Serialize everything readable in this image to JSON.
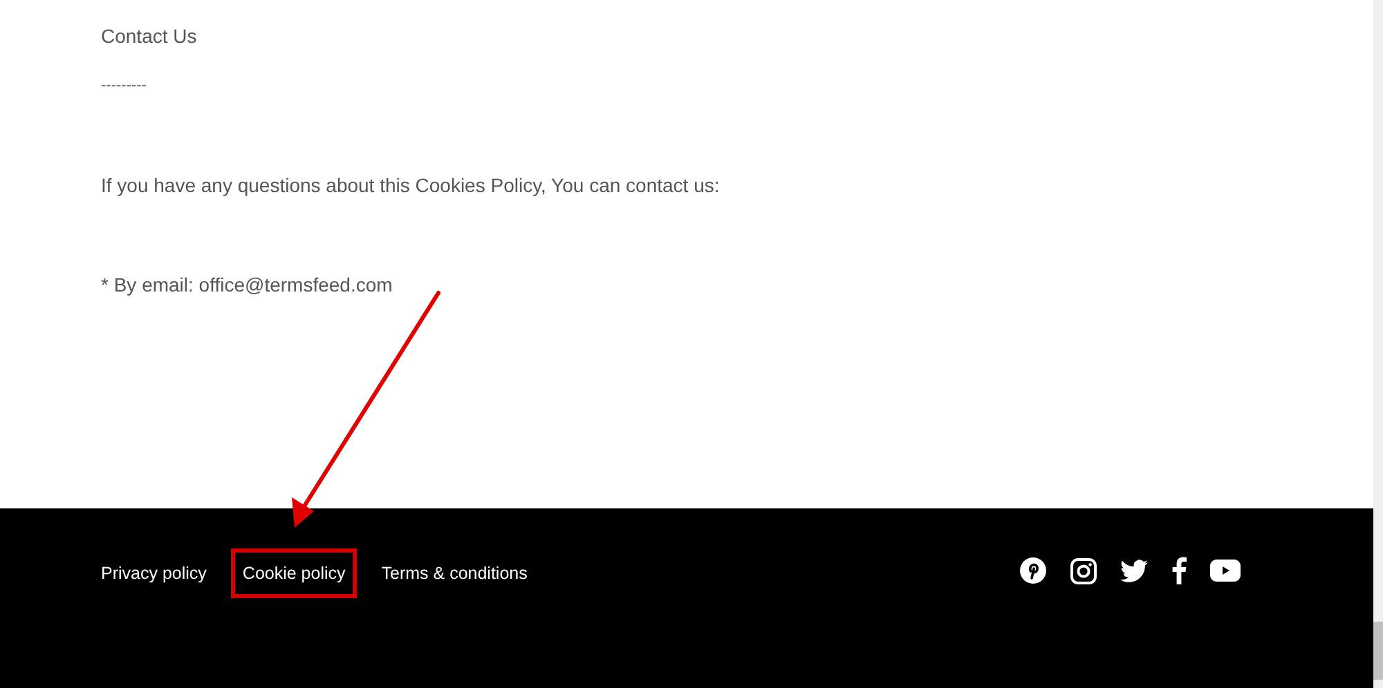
{
  "content": {
    "heading": "Contact Us",
    "separator": "---------",
    "paragraphs": [
      "If you have any questions about this Cookies Policy, You can contact us:",
      "* By email: office@termsfeed.com"
    ]
  },
  "footer": {
    "links": [
      {
        "label": "Privacy policy",
        "highlighted": false
      },
      {
        "label": "Cookie policy",
        "highlighted": true
      },
      {
        "label": "Terms & conditions",
        "highlighted": false
      }
    ],
    "social": [
      {
        "kind": "pinterest"
      },
      {
        "kind": "instagram"
      },
      {
        "kind": "twitter"
      },
      {
        "kind": "facebook"
      },
      {
        "kind": "youtube"
      }
    ]
  }
}
